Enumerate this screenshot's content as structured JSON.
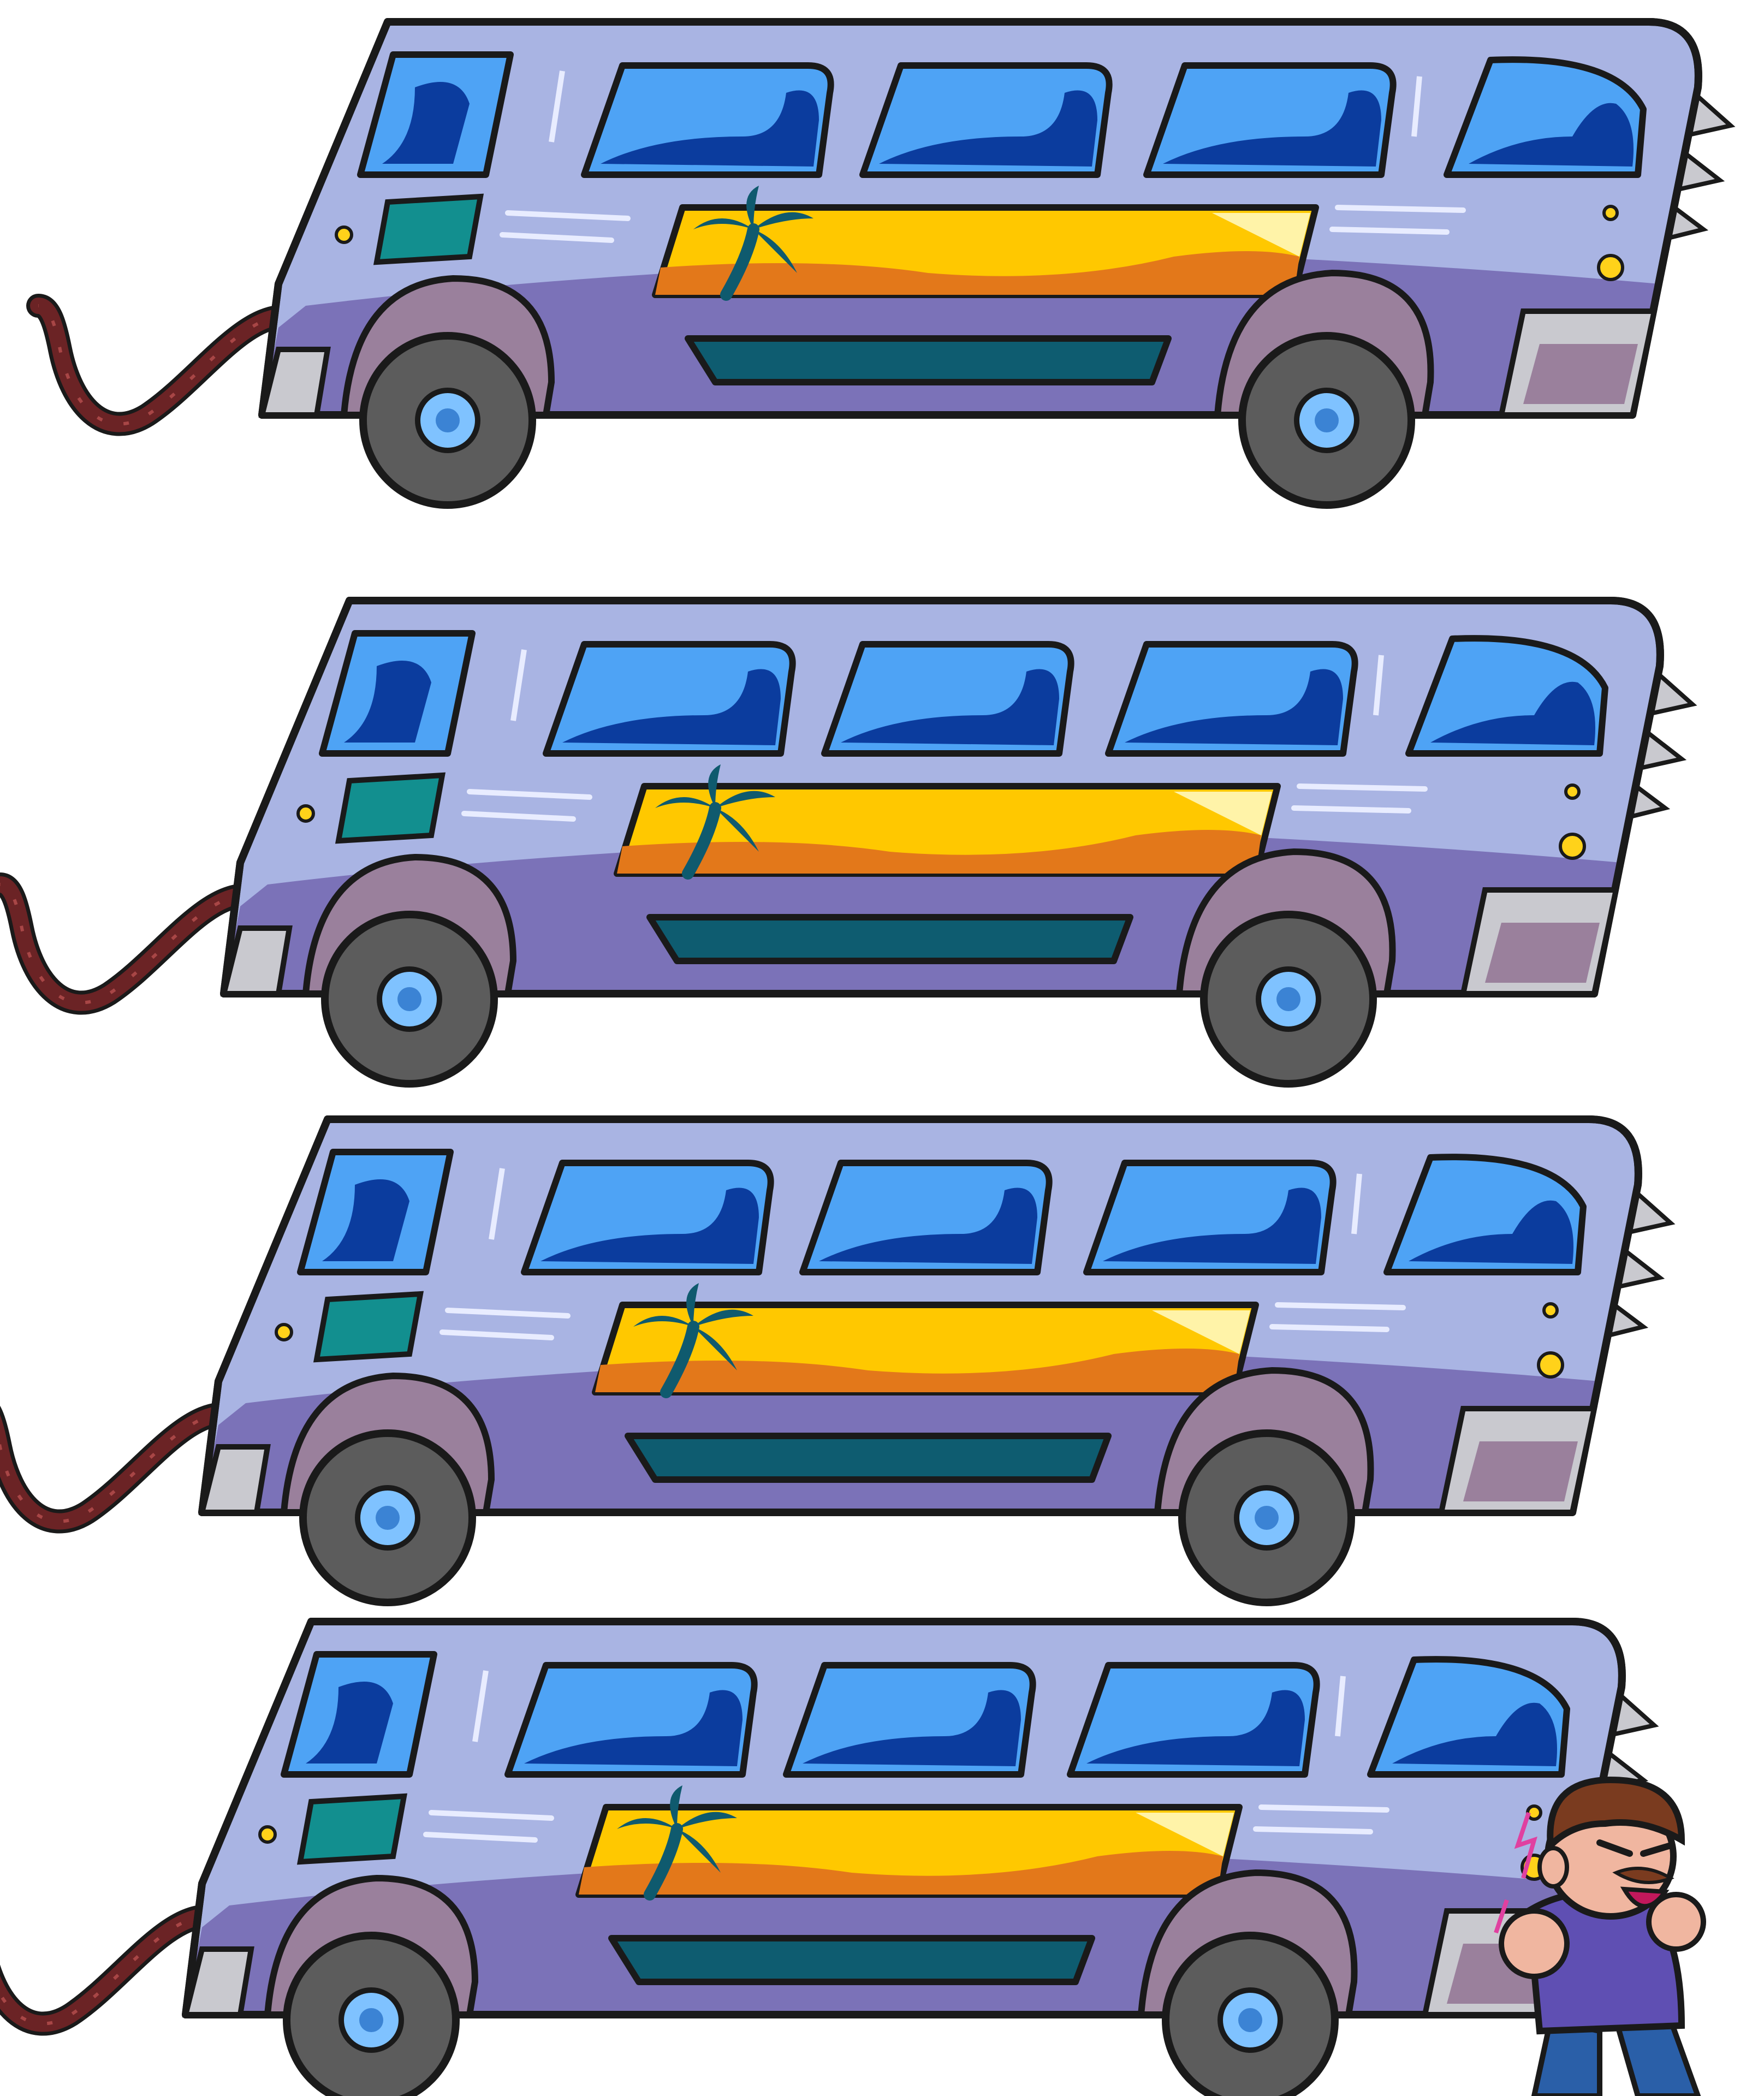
{
  "scene": {
    "description_hidden": "",
    "bus_count": 4,
    "colors": {
      "background": "#ffffff",
      "outline": "#1a1a1a",
      "body_top": "#a9b4e3",
      "body_bottom": "#7b72b8",
      "window_light": "#4ea3f5",
      "window_dark": "#0b3c9e",
      "panel_sky": "#ffc800",
      "panel_sand": "#e3781a",
      "palm": "#0f5a6e",
      "vent": "#0e5c70",
      "fender": "#9a809c",
      "bumper": "#c9c9cf",
      "tire": "#5c5c5c",
      "hub": "#7fc2ff",
      "cable": "#6b2325",
      "headlight": "#ffd21a",
      "door_teal": "#128f8f"
    },
    "character": {
      "hair": "#7a3b1f",
      "skin": "#f0b6a0",
      "shirt": "#5f4fb3",
      "pants": "#2a5fa8"
    }
  }
}
